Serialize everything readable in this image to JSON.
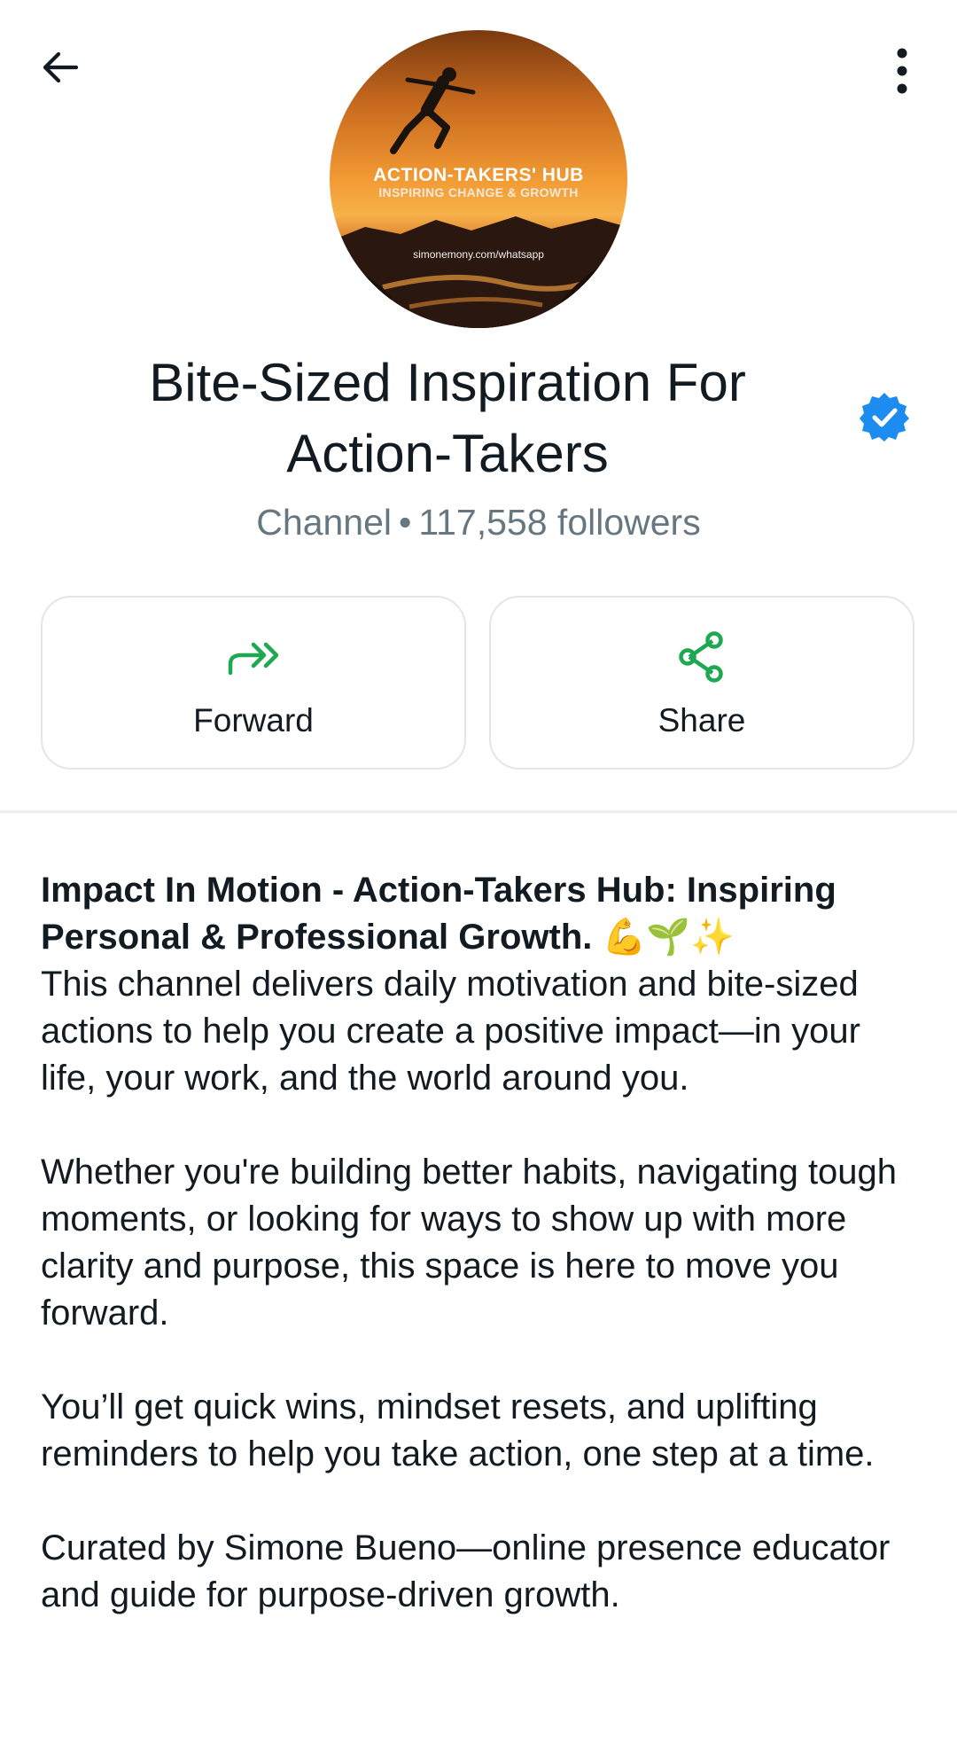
{
  "header": {
    "back_icon": "arrow-left-icon",
    "menu_icon": "more-vert-icon"
  },
  "avatar": {
    "title": "ACTION-TAKERS' HUB",
    "subtitle": "INSPIRING CHANGE & GROWTH",
    "url": "simonemony.com/whatsapp"
  },
  "channel": {
    "name": "Bite-Sized Inspiration For Action-Takers",
    "type": "Channel",
    "separator": "•",
    "followers": "117,558 followers",
    "verified_icon": "verified-badge-icon"
  },
  "actions": {
    "forward_label": "Forward",
    "forward_icon": "forward-icon",
    "share_label": "Share",
    "share_icon": "share-icon"
  },
  "colors": {
    "accent_green": "#1da851",
    "verified_blue": "#1d8cf0",
    "secondary_text": "#667781"
  },
  "description": {
    "headline": "Impact In Motion - Action-Takers Hub: Inspiring Personal & Professional Growth.",
    "headline_emoji": "💪🌱✨",
    "p1": "This channel delivers daily motivation and bite-sized actions to help you create a positive impact—in your life, your work, and the world around you.",
    "p2": "Whether you're building better habits, navigating tough moments, or looking for ways to show up with more clarity and purpose, this space is here to move you forward.",
    "p3": "You’ll get quick wins, mindset resets, and uplifting reminders to help you take action, one step at a time.",
    "p4": "Curated by Simone Bueno—online presence educator and guide for purpose-driven growth."
  }
}
